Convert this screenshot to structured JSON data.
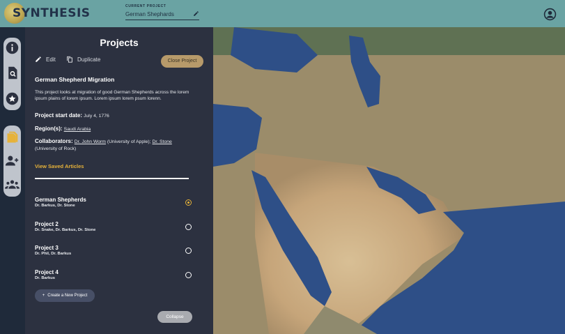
{
  "header": {
    "logo_text": "SYNTHESIS",
    "current_project_label": "CURRENT PROJECT",
    "current_project_value": "German Shephards"
  },
  "panel": {
    "title": "Projects",
    "edit_label": "Edit",
    "duplicate_label": "Duplicate",
    "close_label": "Close Project",
    "project_title": "German Shepherd Migration",
    "project_description": "This project looks at migration of good German Shepherds across the lorem ipsum plains of lorem ipsum. Lorem ipsum lorem psum lorenn.",
    "start_date_label": "Project start date:",
    "start_date_value": "July 4, 1776",
    "regions_label": "Region(s):",
    "regions_value": "Saudi Arabia",
    "collaborators_label": "Collaborators:",
    "collab_1_name": "Dr. John Worm",
    "collab_1_affil": " (University of Apple); ",
    "collab_2_name": "Dr. Stone",
    "collab_2_affil": "(University of Rock)",
    "view_saved_label": "View Saved Articles",
    "projects": [
      {
        "name": "German Shepherds",
        "people": "Dr. Barkus, Dr. Stone",
        "selected": true
      },
      {
        "name": "Project 2",
        "people": "Dr. Snake, Dr. Barkus, Dr. Stone",
        "selected": false
      },
      {
        "name": "Project 3",
        "people": "Dr. Phil, Dr. Barkus",
        "selected": false
      },
      {
        "name": "Project 4",
        "people": "Dr. Barkus",
        "selected": false
      }
    ],
    "create_label": "Create a New Project",
    "collapse_label": "Collapse"
  },
  "colors": {
    "header_bg": "#6aa3a3",
    "panel_bg": "#2c3140",
    "accent": "#e6b23a",
    "close_button": "#b79a6a",
    "sea": "#2e4f87"
  },
  "icons": [
    "info-icon",
    "document-search-icon",
    "star-icon",
    "files-icon",
    "add-user-icon",
    "group-icon",
    "account-icon",
    "pencil-icon",
    "duplicate-icon",
    "plus-icon"
  ]
}
